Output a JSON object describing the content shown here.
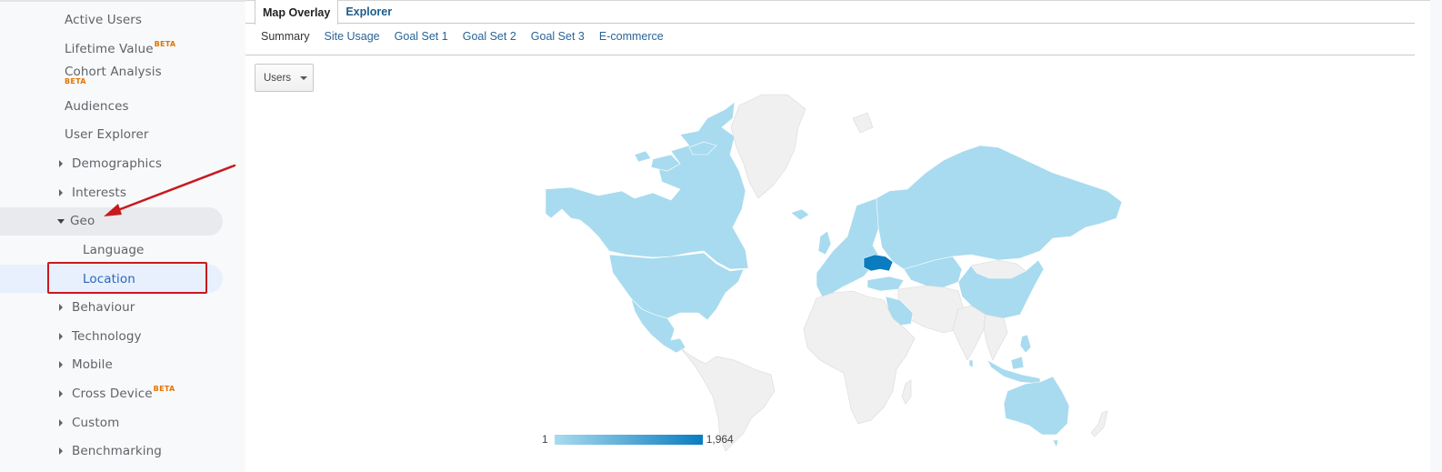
{
  "sidebar": {
    "items": [
      {
        "label": "Active Users",
        "type": "link"
      },
      {
        "label": "Lifetime Value",
        "badge": "BETA",
        "type": "link"
      },
      {
        "label": "Cohort Analysis",
        "badge": "BETA",
        "type": "link"
      },
      {
        "label": "Audiences",
        "type": "link"
      },
      {
        "label": "User Explorer",
        "type": "link"
      },
      {
        "label": "Demographics",
        "type": "collapsed"
      },
      {
        "label": "Interests",
        "type": "collapsed"
      },
      {
        "label": "Geo",
        "type": "expanded"
      },
      {
        "label": "Language",
        "type": "sub"
      },
      {
        "label": "Location",
        "type": "sub",
        "active": true
      },
      {
        "label": "Behaviour",
        "type": "collapsed"
      },
      {
        "label": "Technology",
        "type": "collapsed"
      },
      {
        "label": "Mobile",
        "type": "collapsed"
      },
      {
        "label": "Cross Device",
        "badge": "BETA",
        "type": "collapsed"
      },
      {
        "label": "Custom",
        "type": "collapsed"
      },
      {
        "label": "Benchmarking",
        "type": "collapsed"
      }
    ]
  },
  "annotations": {
    "arrow_target": "Geo",
    "highlight_box_target": "Location",
    "annotation_color": "#c8191f"
  },
  "tabs": [
    {
      "label": "Map Overlay",
      "active": true
    },
    {
      "label": "Explorer",
      "active": false
    }
  ],
  "subtabs": [
    {
      "label": "Summary",
      "active": true
    },
    {
      "label": "Site Usage",
      "active": false
    },
    {
      "label": "Goal Set 1",
      "active": false
    },
    {
      "label": "Goal Set 2",
      "active": false
    },
    {
      "label": "Goal Set 3",
      "active": false
    },
    {
      "label": "E-commerce",
      "active": false
    }
  ],
  "metric_selector": {
    "value": "Users"
  },
  "map": {
    "metric": "Users",
    "legend": {
      "min_label": "1",
      "max_label": "1,964",
      "min": 1,
      "max": 1964
    },
    "colors": {
      "low": "#a8dbef",
      "high": "#0a7cbf",
      "no_data": "#f0f0f0",
      "no_data_border": "#d9d9d9"
    },
    "highlighted_country": "Ukraine",
    "countries_with_data": [
      "Canada",
      "United States",
      "Mexico",
      "Iceland",
      "United Kingdom",
      "Ireland",
      "France",
      "Spain",
      "Portugal",
      "Germany",
      "Poland",
      "Netherlands",
      "Belgium",
      "Italy",
      "Austria",
      "Czechia",
      "Sweden",
      "Norway",
      "Finland",
      "Estonia",
      "Latvia",
      "Lithuania",
      "Belarus",
      "Ukraine",
      "Moldova",
      "Romania",
      "Bulgaria",
      "Greece",
      "Turkey",
      "Georgia",
      "Russia",
      "Kazakhstan",
      "Uzbekistan",
      "Kyrgyzstan",
      "China",
      "Saudi Arabia",
      "Israel",
      "Sri Lanka",
      "Philippines",
      "Malaysia",
      "Indonesia",
      "Australia"
    ]
  }
}
